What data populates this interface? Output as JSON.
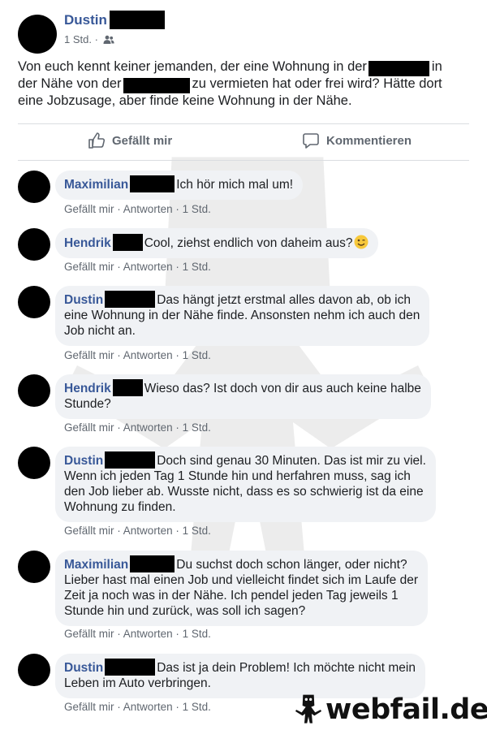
{
  "post": {
    "author": "Dustin",
    "time": "1 Std.",
    "privacy_icon": "friends-icon",
    "text_lines": [
      {
        "a": "Von euch kennt keiner jemanden, der eine Wohnung in der",
        "b": "in"
      },
      {
        "a": "der Nähe von der",
        "b": "zu vermieten hat oder frei wird? Hätte dort"
      },
      {
        "a": "eine Jobzusage, aber finde keine Wohnung in der Nähe."
      }
    ]
  },
  "actions": {
    "like": "Gefällt mir",
    "comment": "Kommentieren"
  },
  "comment_actions": {
    "like": "Gefällt mir",
    "reply": "Antworten",
    "sep": "·"
  },
  "comments": [
    {
      "name": "Maximilian",
      "time": "1 Std.",
      "lines": [
        "Ich hör mich mal um!"
      ]
    },
    {
      "name": "Hendrik",
      "time": "1 Std.",
      "lines": [
        "Cool, ziehst endlich von daheim aus?"
      ],
      "emoji": "winking-face-emoji"
    },
    {
      "name": "Dustin",
      "time": "1 Std.",
      "lines": [
        "Das hängt jetzt erstmal alles davon ab, ob ich",
        "eine Wohnung in der Nähe finde. Ansonsten nehm ich auch den",
        "Job nicht an."
      ]
    },
    {
      "name": "Hendrik",
      "time": "1 Std.",
      "lines": [
        "Wieso das? Ist doch von dir aus auch keine halbe",
        "Stunde?"
      ]
    },
    {
      "name": "Dustin",
      "time": "1 Std.",
      "lines": [
        "Doch sind genau 30 Minuten. Das ist mir zu viel.",
        "Wenn ich jeden Tag 1 Stunde hin und herfahren muss, sag ich",
        "den Job lieber ab. Wusste nicht, dass es so schwierig ist da eine",
        "Wohnung zu finden."
      ]
    },
    {
      "name": "Maximilian",
      "time": "1 Std.",
      "lines": [
        "Du suchst doch schon länger, oder nicht?",
        "Lieber hast mal einen Job und vielleicht findet sich im Laufe der",
        "Zeit ja noch was in der Nähe. Ich pendel jeden Tag jeweils 1",
        "Stunde hin und zurück, was soll ich sagen?"
      ]
    },
    {
      "name": "Dustin",
      "time": "1 Std.",
      "lines": [
        "Das ist ja dein Problem! Ich möchte nicht mein",
        "Leben im Auto verbringen."
      ]
    }
  ],
  "watermark": {
    "text": "webfail.de",
    "icon": "webfail-mascot-icon"
  },
  "colors": {
    "name_link": "#385898",
    "meta": "#606770",
    "bubble_bg": "#f0f2f5",
    "divider": "#dadde1"
  }
}
